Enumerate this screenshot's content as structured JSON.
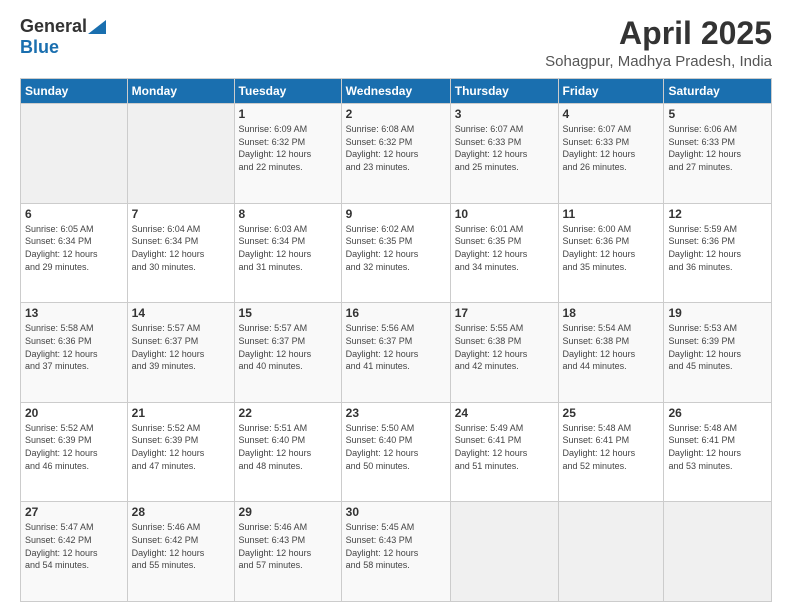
{
  "logo": {
    "general": "General",
    "blue": "Blue"
  },
  "header": {
    "month": "April 2025",
    "location": "Sohagpur, Madhya Pradesh, India"
  },
  "weekdays": [
    "Sunday",
    "Monday",
    "Tuesday",
    "Wednesday",
    "Thursday",
    "Friday",
    "Saturday"
  ],
  "weeks": [
    [
      null,
      null,
      {
        "day": 1,
        "sunrise": "6:09 AM",
        "sunset": "6:32 PM",
        "daylight": "12 hours and 22 minutes."
      },
      {
        "day": 2,
        "sunrise": "6:08 AM",
        "sunset": "6:32 PM",
        "daylight": "12 hours and 23 minutes."
      },
      {
        "day": 3,
        "sunrise": "6:07 AM",
        "sunset": "6:33 PM",
        "daylight": "12 hours and 25 minutes."
      },
      {
        "day": 4,
        "sunrise": "6:07 AM",
        "sunset": "6:33 PM",
        "daylight": "12 hours and 26 minutes."
      },
      {
        "day": 5,
        "sunrise": "6:06 AM",
        "sunset": "6:33 PM",
        "daylight": "12 hours and 27 minutes."
      }
    ],
    [
      {
        "day": 6,
        "sunrise": "6:05 AM",
        "sunset": "6:34 PM",
        "daylight": "12 hours and 29 minutes."
      },
      {
        "day": 7,
        "sunrise": "6:04 AM",
        "sunset": "6:34 PM",
        "daylight": "12 hours and 30 minutes."
      },
      {
        "day": 8,
        "sunrise": "6:03 AM",
        "sunset": "6:34 PM",
        "daylight": "12 hours and 31 minutes."
      },
      {
        "day": 9,
        "sunrise": "6:02 AM",
        "sunset": "6:35 PM",
        "daylight": "12 hours and 32 minutes."
      },
      {
        "day": 10,
        "sunrise": "6:01 AM",
        "sunset": "6:35 PM",
        "daylight": "12 hours and 34 minutes."
      },
      {
        "day": 11,
        "sunrise": "6:00 AM",
        "sunset": "6:36 PM",
        "daylight": "12 hours and 35 minutes."
      },
      {
        "day": 12,
        "sunrise": "5:59 AM",
        "sunset": "6:36 PM",
        "daylight": "12 hours and 36 minutes."
      }
    ],
    [
      {
        "day": 13,
        "sunrise": "5:58 AM",
        "sunset": "6:36 PM",
        "daylight": "12 hours and 37 minutes."
      },
      {
        "day": 14,
        "sunrise": "5:57 AM",
        "sunset": "6:37 PM",
        "daylight": "12 hours and 39 minutes."
      },
      {
        "day": 15,
        "sunrise": "5:57 AM",
        "sunset": "6:37 PM",
        "daylight": "12 hours and 40 minutes."
      },
      {
        "day": 16,
        "sunrise": "5:56 AM",
        "sunset": "6:37 PM",
        "daylight": "12 hours and 41 minutes."
      },
      {
        "day": 17,
        "sunrise": "5:55 AM",
        "sunset": "6:38 PM",
        "daylight": "12 hours and 42 minutes."
      },
      {
        "day": 18,
        "sunrise": "5:54 AM",
        "sunset": "6:38 PM",
        "daylight": "12 hours and 44 minutes."
      },
      {
        "day": 19,
        "sunrise": "5:53 AM",
        "sunset": "6:39 PM",
        "daylight": "12 hours and 45 minutes."
      }
    ],
    [
      {
        "day": 20,
        "sunrise": "5:52 AM",
        "sunset": "6:39 PM",
        "daylight": "12 hours and 46 minutes."
      },
      {
        "day": 21,
        "sunrise": "5:52 AM",
        "sunset": "6:39 PM",
        "daylight": "12 hours and 47 minutes."
      },
      {
        "day": 22,
        "sunrise": "5:51 AM",
        "sunset": "6:40 PM",
        "daylight": "12 hours and 48 minutes."
      },
      {
        "day": 23,
        "sunrise": "5:50 AM",
        "sunset": "6:40 PM",
        "daylight": "12 hours and 50 minutes."
      },
      {
        "day": 24,
        "sunrise": "5:49 AM",
        "sunset": "6:41 PM",
        "daylight": "12 hours and 51 minutes."
      },
      {
        "day": 25,
        "sunrise": "5:48 AM",
        "sunset": "6:41 PM",
        "daylight": "12 hours and 52 minutes."
      },
      {
        "day": 26,
        "sunrise": "5:48 AM",
        "sunset": "6:41 PM",
        "daylight": "12 hours and 53 minutes."
      }
    ],
    [
      {
        "day": 27,
        "sunrise": "5:47 AM",
        "sunset": "6:42 PM",
        "daylight": "12 hours and 54 minutes."
      },
      {
        "day": 28,
        "sunrise": "5:46 AM",
        "sunset": "6:42 PM",
        "daylight": "12 hours and 55 minutes."
      },
      {
        "day": 29,
        "sunrise": "5:46 AM",
        "sunset": "6:43 PM",
        "daylight": "12 hours and 57 minutes."
      },
      {
        "day": 30,
        "sunrise": "5:45 AM",
        "sunset": "6:43 PM",
        "daylight": "12 hours and 58 minutes."
      },
      null,
      null,
      null
    ]
  ],
  "labels": {
    "sunrise": "Sunrise:",
    "sunset": "Sunset:",
    "daylight": "Daylight:"
  }
}
